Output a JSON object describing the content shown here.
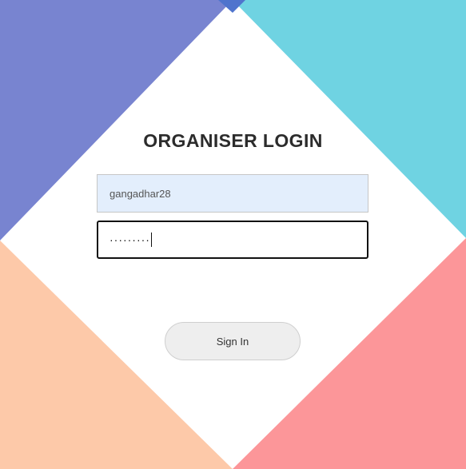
{
  "login": {
    "title": "ORGANISER LOGIN",
    "username_value": "gangadhar28",
    "password_masked": "·········",
    "signin_label": "Sign In"
  },
  "colors": {
    "top_left": "#7884d0",
    "top_right": "#6fd3e2",
    "bottom_left": "#fdc9a9",
    "bottom_right": "#fc9699",
    "corner_accent": "#4f74cd"
  }
}
